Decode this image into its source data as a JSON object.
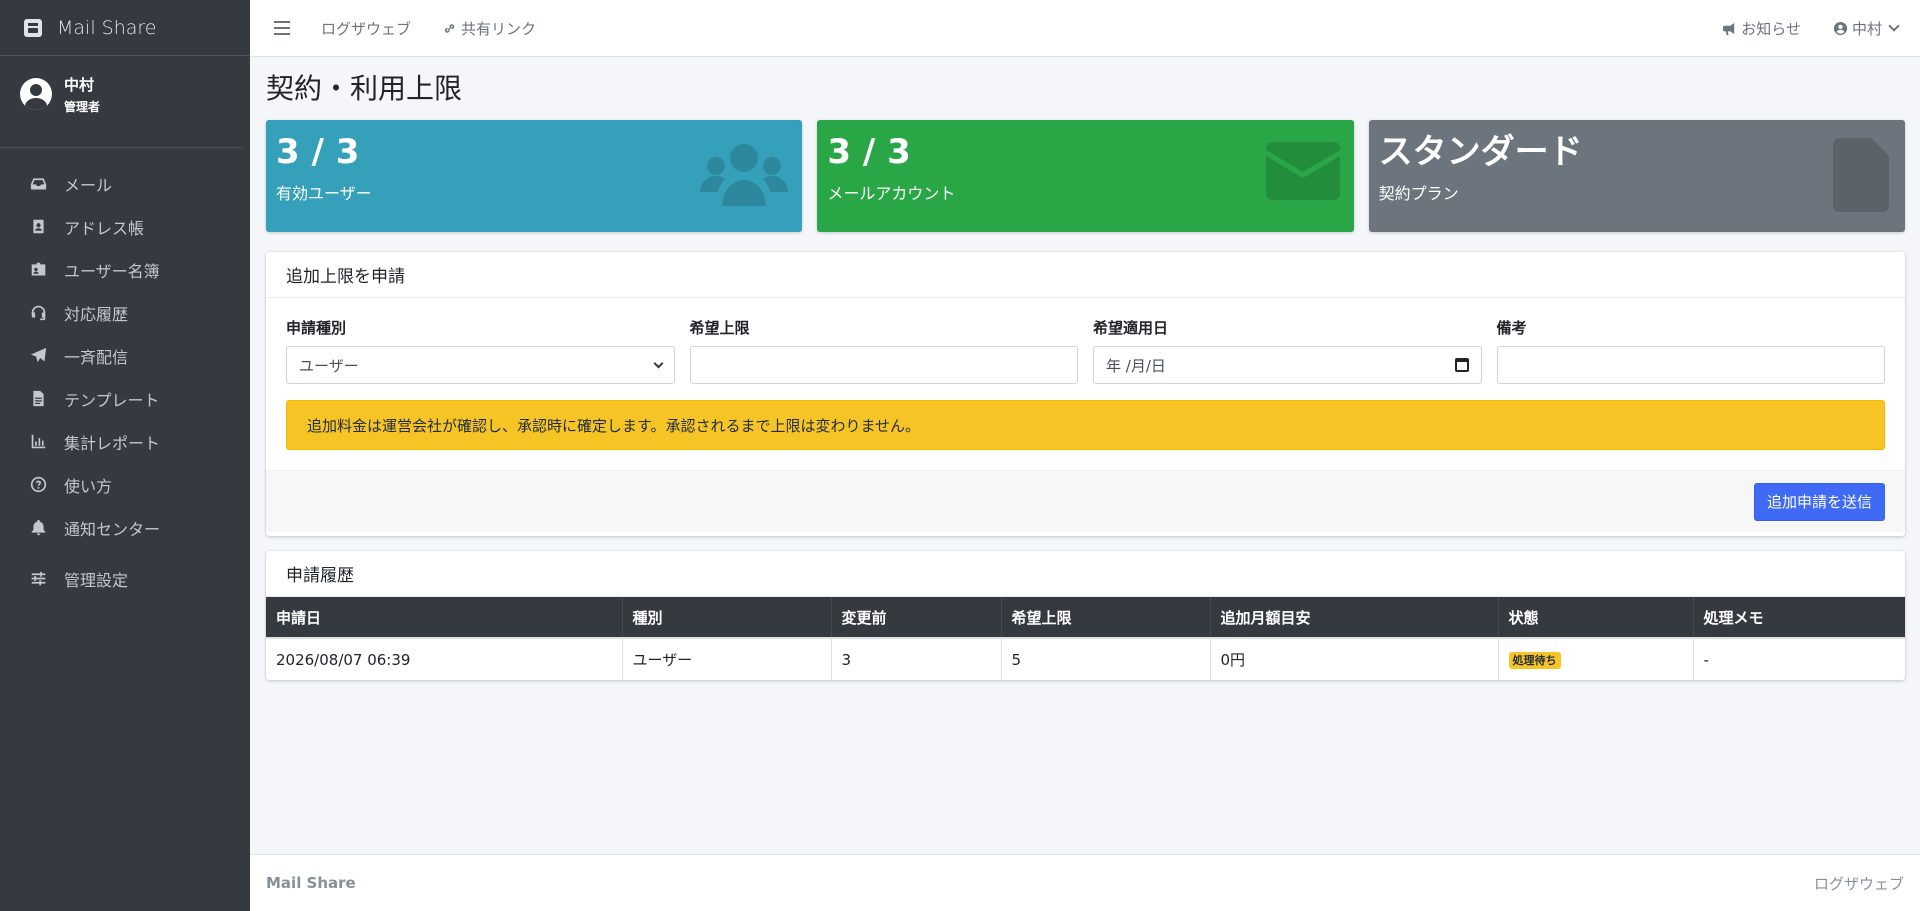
{
  "brand": {
    "name": "Mail Share",
    "icon": "mailbox-icon"
  },
  "user": {
    "name": "中村",
    "role": "管理者"
  },
  "sidebar": {
    "items": [
      {
        "label": "メール",
        "icon": "inbox-icon"
      },
      {
        "label": "アドレス帳",
        "icon": "address-book-icon"
      },
      {
        "label": "ユーザー名簿",
        "icon": "id-badge-icon"
      },
      {
        "label": "対応履歴",
        "icon": "headset-icon"
      },
      {
        "label": "一斉配信",
        "icon": "paper-plane-icon"
      },
      {
        "label": "テンプレート",
        "icon": "file-icon"
      },
      {
        "label": "集計レポート",
        "icon": "chart-icon"
      },
      {
        "label": "使い方",
        "icon": "question-circle-icon"
      },
      {
        "label": "通知センター",
        "icon": "bell-icon"
      },
      {
        "label": "管理設定",
        "icon": "sliders-icon"
      }
    ]
  },
  "topbar": {
    "links": [
      "ログザウェブ",
      "共有リンク"
    ],
    "notice": "お知らせ",
    "user": "中村"
  },
  "page": {
    "title": "契約・利用上限"
  },
  "stats": [
    {
      "value": "3 / 3",
      "label": "有効ユーザー",
      "icon": "users-icon",
      "color": "#35a0b9"
    },
    {
      "value": "3 / 3",
      "label": "メールアカウント",
      "icon": "envelope-icon",
      "color": "#29a746"
    },
    {
      "value": "スタンダード",
      "label": "契約プラン",
      "icon": "file-contract-icon",
      "color": "#6c757d"
    }
  ],
  "request_form": {
    "title": "追加上限を申請",
    "fields": {
      "type": {
        "label": "申請種別",
        "value": "ユーザー"
      },
      "limit": {
        "label": "希望上限",
        "value": ""
      },
      "date": {
        "label": "希望適用日",
        "placeholder": "年 /月/日"
      },
      "note": {
        "label": "備考",
        "value": ""
      }
    },
    "alert": "追加料金は運営会社が確認し、承認時に確定します。承認されるまで上限は変わりません。",
    "submit": "追加申請を送信"
  },
  "history": {
    "title": "申請履歴",
    "columns": [
      "申請日",
      "種別",
      "変更前",
      "希望上限",
      "追加月額目安",
      "状態",
      "処理メモ"
    ],
    "rows": [
      {
        "date": "2026/08/07 06:39",
        "type": "ユーザー",
        "before": "3",
        "limit": "5",
        "fee": "0円",
        "status": "処理待ち",
        "memo": "-"
      }
    ]
  },
  "footer": {
    "left": "Mail Share",
    "right": "ログザウェブ"
  }
}
